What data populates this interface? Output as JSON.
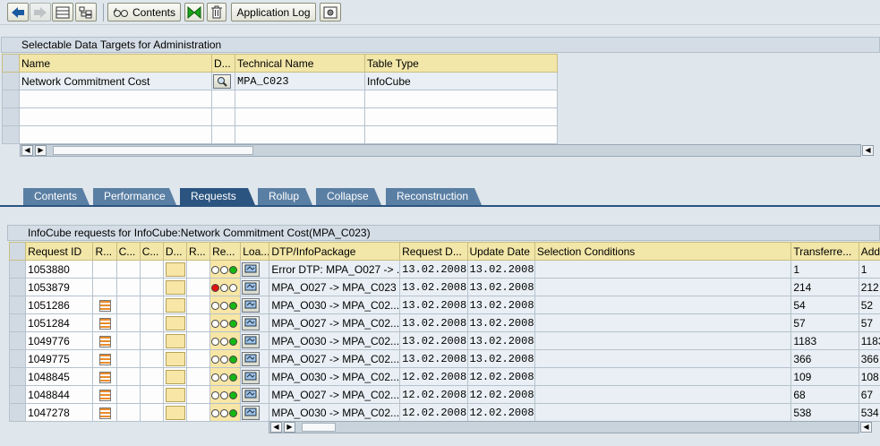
{
  "toolbar": {
    "contents_label": "Contents",
    "application_log_label": "Application Log"
  },
  "targets": {
    "title": "Selectable Data Targets for Administration",
    "columns": [
      "Name",
      "D...",
      "Technical Name",
      "Table Type"
    ],
    "row": {
      "name": "Network Commitment Cost",
      "technical_name": "MPA_C023",
      "table_type": "InfoCube"
    }
  },
  "tabs": [
    {
      "label": "Contents"
    },
    {
      "label": "Performance"
    },
    {
      "label": "Requests",
      "active": true
    },
    {
      "label": "Rollup"
    },
    {
      "label": "Collapse"
    },
    {
      "label": "Reconstruction"
    }
  ],
  "requests": {
    "title": "InfoCube requests for InfoCube:Network Commitment Cost(MPA_C023)",
    "columns": [
      "Request ID",
      "R...",
      "C...",
      "C...",
      "D...",
      "R...",
      "Re...",
      "Loa...",
      "DTP/InfoPackage",
      "Request D...",
      "Update Date",
      "Selection Conditions",
      "Transferre...",
      "Adde"
    ],
    "rows": [
      {
        "id": "1053880",
        "doc": false,
        "light": "green",
        "dtp": "Error DTP: MPA_O027 -> ...",
        "req_date": "13.02.2008",
        "upd_date": "13.02.2008",
        "transferred": "1",
        "added": "1"
      },
      {
        "id": "1053879",
        "doc": false,
        "light": "red",
        "dtp": "MPA_O027 -> MPA_C023",
        "req_date": "13.02.2008",
        "upd_date": "13.02.2008",
        "transferred": "214",
        "added": "212"
      },
      {
        "id": "1051286",
        "doc": true,
        "light": "green",
        "dtp": "MPA_O030 -> MPA_C02...",
        "req_date": "13.02.2008",
        "upd_date": "13.02.2008",
        "transferred": "54",
        "added": "52"
      },
      {
        "id": "1051284",
        "doc": true,
        "light": "green",
        "dtp": "MPA_O027 -> MPA_C02...",
        "req_date": "13.02.2008",
        "upd_date": "13.02.2008",
        "transferred": "57",
        "added": "57"
      },
      {
        "id": "1049776",
        "doc": true,
        "light": "green",
        "dtp": "MPA_O030 -> MPA_C02...",
        "req_date": "13.02.2008",
        "upd_date": "13.02.2008",
        "transferred": "1183",
        "added": "1183"
      },
      {
        "id": "1049775",
        "doc": true,
        "light": "green",
        "dtp": "MPA_O027 -> MPA_C02...",
        "req_date": "13.02.2008",
        "upd_date": "13.02.2008",
        "transferred": "366",
        "added": "366"
      },
      {
        "id": "1048845",
        "doc": true,
        "light": "green",
        "dtp": "MPA_O030 -> MPA_C02...",
        "req_date": "12.02.2008",
        "upd_date": "12.02.2008",
        "transferred": "109",
        "added": "108"
      },
      {
        "id": "1048844",
        "doc": true,
        "light": "green",
        "dtp": "MPA_O027 -> MPA_C02...",
        "req_date": "12.02.2008",
        "upd_date": "12.02.2008",
        "transferred": "68",
        "added": "67"
      },
      {
        "id": "1047278",
        "doc": true,
        "light": "green",
        "dtp": "MPA_O030 -> MPA_C02...",
        "req_date": "12.02.2008",
        "upd_date": "12.02.2008",
        "transferred": "538",
        "added": "534"
      }
    ]
  },
  "icons": [
    "back-arrow-icon",
    "forward-arrow-icon",
    "list-view-icon",
    "hierarchy-icon",
    "glasses-icon",
    "execute-icon",
    "delete-icon",
    "settings-icon",
    "magnifier-icon",
    "traffic-light-icon",
    "document-icon"
  ]
}
